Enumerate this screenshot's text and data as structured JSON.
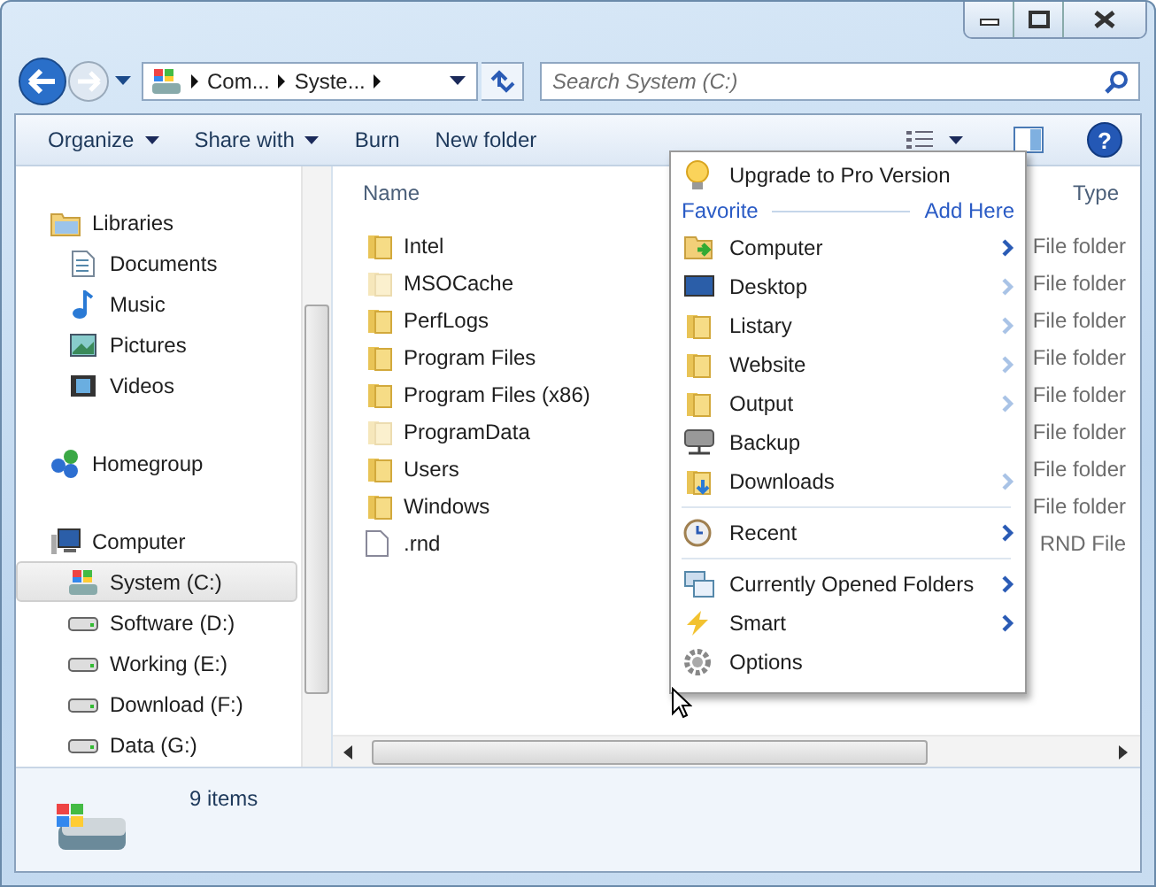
{
  "address": {
    "crumbs": [
      "Com...",
      "Syste..."
    ]
  },
  "search": {
    "placeholder": "Search System (C:)"
  },
  "toolbar": [
    {
      "label": "Organize",
      "dropdown": true
    },
    {
      "label": "Share with",
      "dropdown": true
    },
    {
      "label": "Burn",
      "dropdown": false
    },
    {
      "label": "New folder",
      "dropdown": false
    }
  ],
  "sidebar": {
    "groups": [
      {
        "label": "Libraries",
        "kind": "library",
        "selected": false,
        "children": [
          {
            "label": "Documents",
            "kind": "document",
            "selected": false
          },
          {
            "label": "Music",
            "kind": "music",
            "selected": false
          },
          {
            "label": "Pictures",
            "kind": "picture",
            "selected": false
          },
          {
            "label": "Videos",
            "kind": "video",
            "selected": false
          }
        ]
      },
      {
        "label": "Homegroup",
        "kind": "homegroup",
        "selected": false
      },
      {
        "label": "Computer",
        "kind": "computer",
        "selected": false,
        "children": [
          {
            "label": "System (C:)",
            "kind": "system-drive",
            "selected": true
          },
          {
            "label": "Software (D:)",
            "kind": "drive",
            "selected": false
          },
          {
            "label": "Working (E:)",
            "kind": "drive",
            "selected": false
          },
          {
            "label": "Download (F:)",
            "kind": "drive",
            "selected": false
          },
          {
            "label": "Data (G:)",
            "kind": "drive",
            "selected": false
          }
        ]
      }
    ]
  },
  "files": {
    "columns": [
      "Name",
      "Type"
    ],
    "rows": [
      {
        "name": "Intel",
        "kind": "folder",
        "hidden": false,
        "type": "File folder"
      },
      {
        "name": "MSOCache",
        "kind": "folder",
        "hidden": true,
        "type": "File folder"
      },
      {
        "name": "PerfLogs",
        "kind": "folder",
        "hidden": false,
        "type": "File folder"
      },
      {
        "name": "Program Files",
        "kind": "folder",
        "hidden": false,
        "type": "File folder"
      },
      {
        "name": "Program Files (x86)",
        "kind": "folder",
        "hidden": false,
        "type": "File folder"
      },
      {
        "name": "ProgramData",
        "kind": "folder",
        "hidden": true,
        "type": "File folder"
      },
      {
        "name": "Users",
        "kind": "folder",
        "hidden": false,
        "type": "File folder"
      },
      {
        "name": "Windows",
        "kind": "folder",
        "hidden": false,
        "type": "File folder"
      },
      {
        "name": ".rnd",
        "kind": "file",
        "hidden": false,
        "type": "RND File"
      }
    ]
  },
  "menu": {
    "upgrade": "Upgrade to Pro Version",
    "favorite": "Favorite",
    "add_here": "Add Here",
    "sections": [
      [
        {
          "label": "Computer",
          "kind": "computer",
          "submenu": true,
          "dimmed": false
        },
        {
          "label": "Desktop",
          "kind": "desktop",
          "submenu": true,
          "dimmed": true
        },
        {
          "label": "Listary",
          "kind": "folder",
          "submenu": true,
          "dimmed": true
        },
        {
          "label": "Website",
          "kind": "folder",
          "submenu": true,
          "dimmed": true
        },
        {
          "label": "Output",
          "kind": "folder",
          "submenu": true,
          "dimmed": true
        },
        {
          "label": "Backup",
          "kind": "backup",
          "submenu": false
        },
        {
          "label": "Downloads",
          "kind": "downloads",
          "submenu": true,
          "dimmed": true
        }
      ],
      [
        {
          "label": "Recent",
          "kind": "recent",
          "submenu": true,
          "dimmed": false
        }
      ],
      [
        {
          "label": "Currently Opened Folders",
          "kind": "windows",
          "submenu": true,
          "dimmed": false
        },
        {
          "label": "Smart",
          "kind": "smart",
          "submenu": true,
          "dimmed": false
        },
        {
          "label": "Options",
          "kind": "options",
          "submenu": false
        }
      ]
    ]
  },
  "help": "?",
  "status": {
    "count": "9 items"
  }
}
